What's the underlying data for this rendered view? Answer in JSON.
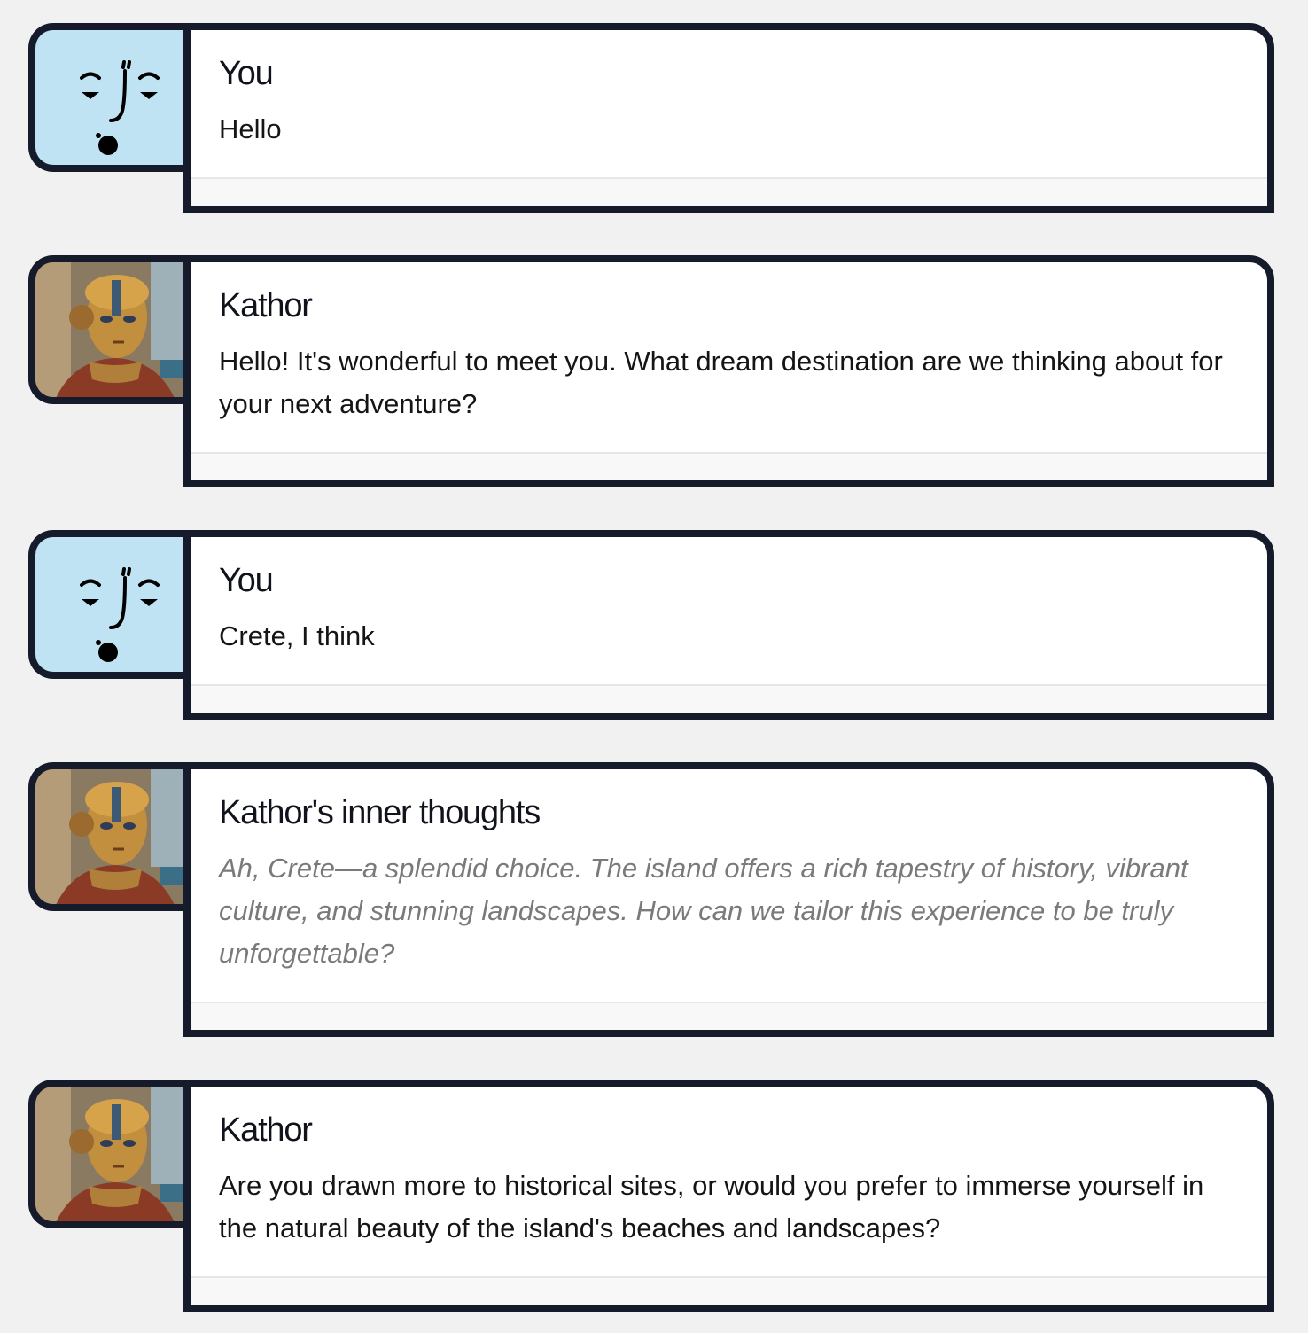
{
  "messages": [
    {
      "author": "You",
      "text": "Hello",
      "avatar": "user-face-icon",
      "kind": "normal"
    },
    {
      "author": "Kathor",
      "text": "Hello! It's wonderful to meet you. What dream destination are we thinking about for your next adventure?",
      "avatar": "kathor-portrait",
      "kind": "normal"
    },
    {
      "author": "You",
      "text": "Crete, I think",
      "avatar": "user-face-icon",
      "kind": "normal"
    },
    {
      "author": "Kathor's inner thoughts",
      "text": "Ah, Crete—a splendid choice. The island offers a rich tapestry of history, vibrant culture, and stunning landscapes. How can we tailor this experience to be truly unforgettable?",
      "avatar": "kathor-portrait",
      "kind": "thought"
    },
    {
      "author": "Kathor",
      "text": "Are you drawn more to historical sites, or would you prefer to immerse yourself in the natural beauty of the island's beaches and landscapes?",
      "avatar": "kathor-portrait",
      "kind": "normal"
    }
  ],
  "colors": {
    "page_background": "#f1f1f1",
    "border": "#161b2b",
    "user_avatar_background": "#c0e3f4",
    "thought_text": "#7a7a7a"
  }
}
